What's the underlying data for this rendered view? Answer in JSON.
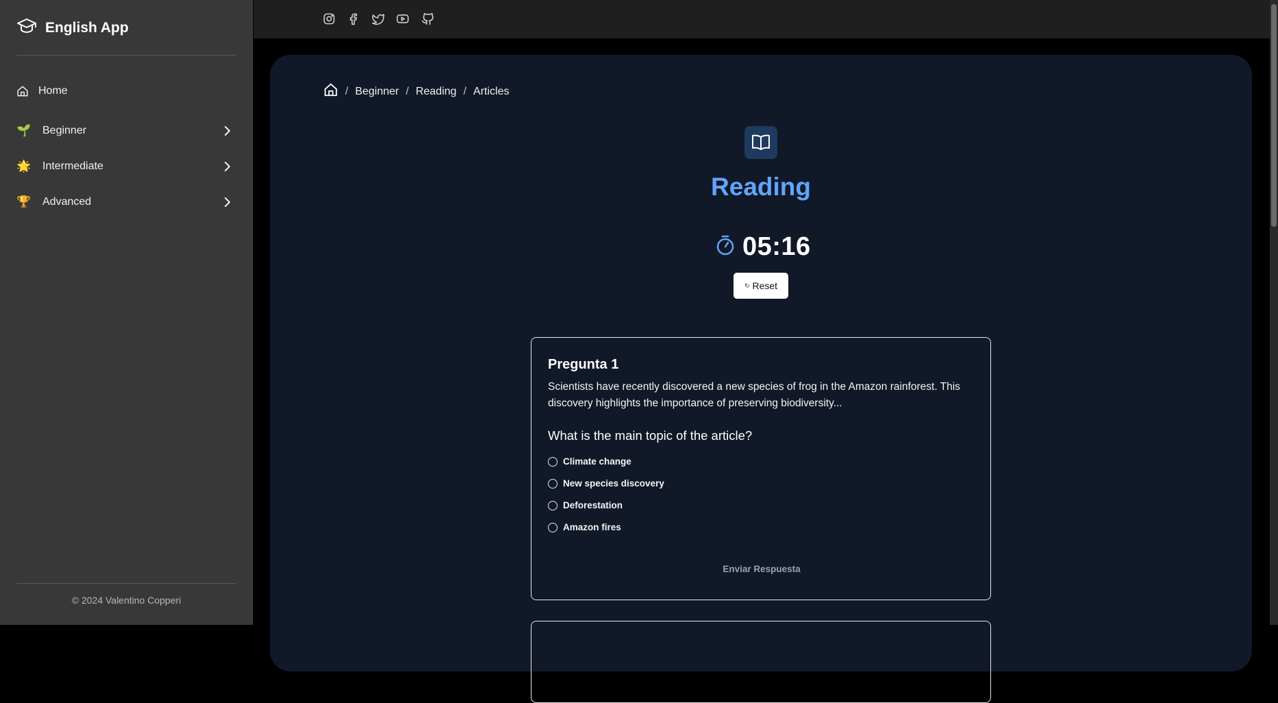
{
  "sidebar": {
    "brand": "English App",
    "items": [
      {
        "label": "Home",
        "icon": "home-icon"
      },
      {
        "label": "Beginner",
        "icon": "seedling-icon",
        "emoji": "🌱"
      },
      {
        "label": "Intermediate",
        "icon": "sun-icon",
        "emoji": "🌟"
      },
      {
        "label": "Advanced",
        "icon": "trophy-icon",
        "emoji": "🏆"
      }
    ],
    "copyright": "© 2024 Valentino Copperi"
  },
  "topbar": {
    "socials": [
      "instagram-icon",
      "facebook-icon",
      "twitter-icon",
      "youtube-icon",
      "github-icon"
    ]
  },
  "breadcrumb": [
    "Beginner",
    "Reading",
    "Articles"
  ],
  "page": {
    "title": "Reading",
    "timer": "05:16",
    "reset_label": "Reset",
    "accent_color": "#60a5fa"
  },
  "question": {
    "title": "Pregunta 1",
    "text": "Scientists have recently discovered a new species of frog in the Amazon rainforest. This discovery highlights the importance of preserving biodiversity...",
    "prompt": "What is the main topic of the article?",
    "options": [
      "Climate change",
      "New species discovery",
      "Deforestation",
      "Amazon fires"
    ],
    "submit_label": "Enviar Respuesta"
  }
}
